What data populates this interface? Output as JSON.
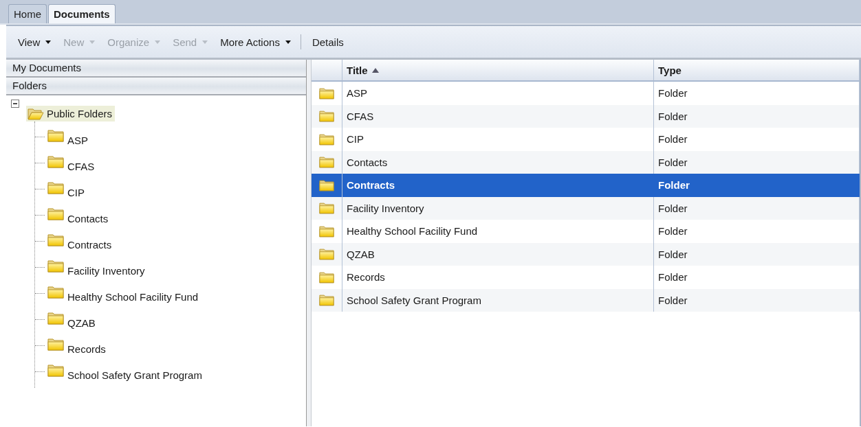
{
  "tabs": [
    {
      "label": "Home",
      "selected": false
    },
    {
      "label": "Documents",
      "selected": true
    }
  ],
  "toolbar": [
    {
      "kind": "menu",
      "label": "View",
      "disabled": false
    },
    {
      "kind": "menu",
      "label": "New",
      "disabled": true
    },
    {
      "kind": "menu",
      "label": "Organize",
      "disabled": true
    },
    {
      "kind": "menu",
      "label": "Send",
      "disabled": true
    },
    {
      "kind": "menu",
      "label": "More Actions",
      "disabled": false
    },
    {
      "kind": "separator"
    },
    {
      "kind": "button",
      "label": "Details",
      "disabled": false
    }
  ],
  "sidebar": {
    "sections": [
      "My Documents",
      "Folders"
    ],
    "tree": {
      "label": "Public Folders",
      "expanded": true,
      "selected": true,
      "children": [
        {
          "label": "ASP"
        },
        {
          "label": "CFAS"
        },
        {
          "label": "CIP"
        },
        {
          "label": "Contacts"
        },
        {
          "label": "Contracts"
        },
        {
          "label": "Facility Inventory"
        },
        {
          "label": "Healthy School Facility Fund"
        },
        {
          "label": "QZAB"
        },
        {
          "label": "Records"
        },
        {
          "label": "School Safety Grant Program"
        }
      ]
    }
  },
  "grid": {
    "columns": [
      {
        "label": "Title",
        "sorted": true
      },
      {
        "label": "Type",
        "sorted": false
      }
    ],
    "rows": [
      {
        "title": "ASP",
        "type": "Folder",
        "selected": false
      },
      {
        "title": "CFAS",
        "type": "Folder",
        "selected": false
      },
      {
        "title": "CIP",
        "type": "Folder",
        "selected": false
      },
      {
        "title": "Contacts",
        "type": "Folder",
        "selected": false
      },
      {
        "title": "Contracts",
        "type": "Folder",
        "selected": true
      },
      {
        "title": "Facility Inventory",
        "type": "Folder",
        "selected": false
      },
      {
        "title": "Healthy School Facility Fund",
        "type": "Folder",
        "selected": false
      },
      {
        "title": "QZAB",
        "type": "Folder",
        "selected": false
      },
      {
        "title": "Records",
        "type": "Folder",
        "selected": false
      },
      {
        "title": "School Safety Grant Program",
        "type": "Folder",
        "selected": false
      }
    ]
  }
}
